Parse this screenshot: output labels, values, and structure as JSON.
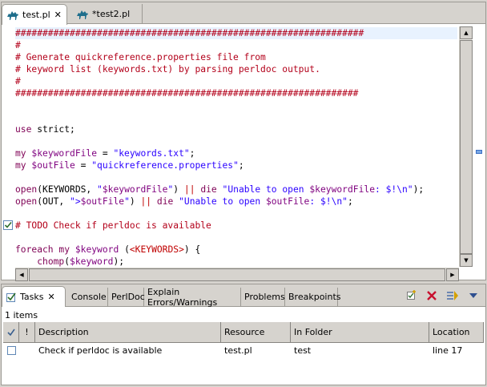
{
  "editor": {
    "tabs": [
      {
        "label": "test.pl",
        "active": true,
        "icon": "camel-icon"
      },
      {
        "label": "*test2.pl",
        "active": false,
        "icon": "camel-icon"
      }
    ],
    "code_lines": [
      [
        {
          "t": "################################################################",
          "c": "cm"
        }
      ],
      [
        {
          "t": "#",
          "c": "cm"
        }
      ],
      [
        {
          "t": "# Generate quickreference.properties file from",
          "c": "cm"
        }
      ],
      [
        {
          "t": "# keyword list (keywords.txt) by parsing perldoc output.",
          "c": "cm"
        }
      ],
      [
        {
          "t": "#",
          "c": "cm"
        }
      ],
      [
        {
          "t": "###############################################################",
          "c": "cm"
        }
      ],
      [],
      [],
      [
        {
          "t": "use",
          "c": "kw"
        },
        {
          "t": " strict;",
          "c": ""
        }
      ],
      [],
      [
        {
          "t": "my",
          "c": "kw"
        },
        {
          "t": " ",
          "c": ""
        },
        {
          "t": "$keywordFile",
          "c": "vr"
        },
        {
          "t": " = ",
          "c": ""
        },
        {
          "t": "\"keywords.txt\"",
          "c": "st"
        },
        {
          "t": ";",
          "c": ""
        }
      ],
      [
        {
          "t": "my",
          "c": "kw"
        },
        {
          "t": " ",
          "c": ""
        },
        {
          "t": "$outFile",
          "c": "vr"
        },
        {
          "t": " = ",
          "c": ""
        },
        {
          "t": "\"quickreference.properties\"",
          "c": "st"
        },
        {
          "t": ";",
          "c": ""
        }
      ],
      [],
      [
        {
          "t": "open",
          "c": "kw"
        },
        {
          "t": "(KEYWORDS, ",
          "c": ""
        },
        {
          "t": "\"",
          "c": "st"
        },
        {
          "t": "$keywordFile",
          "c": "vr"
        },
        {
          "t": "\"",
          "c": "st"
        },
        {
          "t": ") ",
          "c": ""
        },
        {
          "t": "||",
          "c": "op"
        },
        {
          "t": " ",
          "c": ""
        },
        {
          "t": "die",
          "c": "kw"
        },
        {
          "t": " ",
          "c": ""
        },
        {
          "t": "\"Unable to open ",
          "c": "st"
        },
        {
          "t": "$keywordFile",
          "c": "vr"
        },
        {
          "t": ": $!\\n\"",
          "c": "st"
        },
        {
          "t": ");",
          "c": ""
        }
      ],
      [
        {
          "t": "open",
          "c": "kw"
        },
        {
          "t": "(OUT, ",
          "c": ""
        },
        {
          "t": "\">",
          "c": "st"
        },
        {
          "t": "$outFile",
          "c": "vr"
        },
        {
          "t": "\"",
          "c": "st"
        },
        {
          "t": ") ",
          "c": ""
        },
        {
          "t": "||",
          "c": "op"
        },
        {
          "t": " ",
          "c": ""
        },
        {
          "t": "die",
          "c": "kw"
        },
        {
          "t": " ",
          "c": ""
        },
        {
          "t": "\"Unable to open ",
          "c": "st"
        },
        {
          "t": "$outFile",
          "c": "vr"
        },
        {
          "t": ": $!\\n\"",
          "c": "st"
        },
        {
          "t": ";",
          "c": ""
        }
      ],
      [],
      [
        {
          "t": "# TODO Check if perldoc is available",
          "c": "cm"
        }
      ],
      [],
      [
        {
          "t": "foreach",
          "c": "kw"
        },
        {
          "t": " ",
          "c": ""
        },
        {
          "t": "my",
          "c": "kw"
        },
        {
          "t": " ",
          "c": ""
        },
        {
          "t": "$keyword",
          "c": "vr"
        },
        {
          "t": " (",
          "c": ""
        },
        {
          "t": "<KEYWORDS>",
          "c": "op"
        },
        {
          "t": ") {",
          "c": ""
        }
      ],
      [
        {
          "t": "    ",
          "c": ""
        },
        {
          "t": "chomp",
          "c": "kw"
        },
        {
          "t": "(",
          "c": ""
        },
        {
          "t": "$keyword",
          "c": "vr"
        },
        {
          "t": ");",
          "c": ""
        }
      ]
    ]
  },
  "views": {
    "tabs": [
      {
        "label": "Tasks",
        "active": true
      },
      {
        "label": "Console"
      },
      {
        "label": "PerlDoc"
      },
      {
        "label": "Explain Errors/Warnings"
      },
      {
        "label": "Problems"
      },
      {
        "label": "Breakpoints"
      }
    ]
  },
  "tasks": {
    "count_text": "1 items",
    "columns": [
      "",
      "!",
      "Description",
      "Resource",
      "In Folder",
      "Location"
    ],
    "rows": [
      {
        "done": false,
        "priority": "",
        "description": "Check if perldoc is available",
        "resource": "test.pl",
        "folder": "test",
        "location": "line 17"
      }
    ]
  },
  "colors": {
    "keyword": "#7f0055",
    "comment": "#b3001a",
    "string": "#2a00ff",
    "variable": "#7f007f"
  }
}
